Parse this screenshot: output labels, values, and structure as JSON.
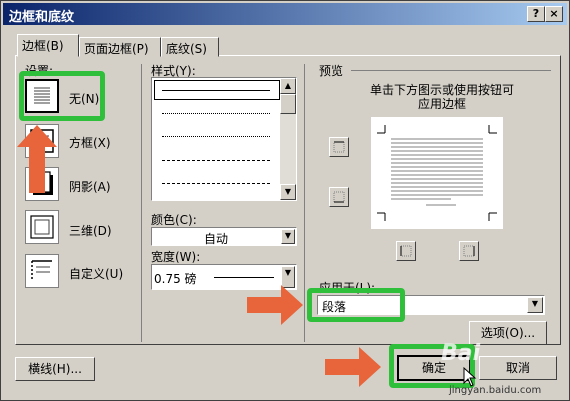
{
  "dialog": {
    "title": "边框和底纹",
    "help_btn": "?",
    "close_btn": "×"
  },
  "tabs": [
    {
      "label": "边框(B)",
      "selected": true
    },
    {
      "label": "页面边框(P)",
      "selected": false
    },
    {
      "label": "底纹(S)",
      "selected": false
    }
  ],
  "settings": {
    "label": "设置:",
    "options": [
      {
        "label": "无(N)",
        "selected": true
      },
      {
        "label": "方框(X)"
      },
      {
        "label": "阴影(A)"
      },
      {
        "label": "三维(D)"
      },
      {
        "label": "自定义(U)"
      }
    ]
  },
  "style": {
    "label": "样式(Y):"
  },
  "color": {
    "label": "颜色(C):",
    "value": "自动"
  },
  "width": {
    "label": "宽度(W):",
    "value": "0.75 磅"
  },
  "preview": {
    "label": "预览",
    "hint_line1": "单击下方图示或使用按钮可",
    "hint_line2": "应用边框"
  },
  "apply_to": {
    "label": "应用于(L):",
    "value": "段落"
  },
  "buttons": {
    "options": "选项(O)...",
    "horizontal_line": "横线(H)...",
    "ok": "确定",
    "cancel": "取消"
  },
  "watermark": {
    "line1": "Bai",
    "line2": "jingyan.baidu.com"
  },
  "colors": {
    "highlight": "#2fbf3a",
    "arrow": "#e8643a",
    "titlebar": "#0a246a"
  }
}
